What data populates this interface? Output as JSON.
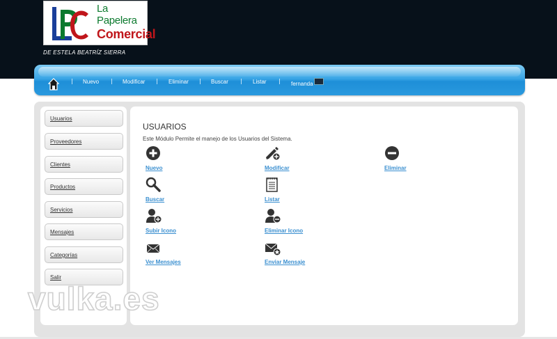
{
  "brand": {
    "logo_line1": "La",
    "logo_line2": "Papelera",
    "logo_line3": "Comercial",
    "tagline": "DE ESTELA BEATRÍZ SIERRA"
  },
  "nav": {
    "items": [
      {
        "label": "Nuevo"
      },
      {
        "label": "Modificar"
      },
      {
        "label": "Eliminar"
      },
      {
        "label": "Buscar"
      },
      {
        "label": "Listar"
      }
    ],
    "user": "fernanda"
  },
  "sidebar": {
    "items": [
      {
        "label": "Usuarios"
      },
      {
        "label": "Proveedores"
      },
      {
        "label": "Clientes"
      },
      {
        "label": "Productos"
      },
      {
        "label": "Servicios"
      },
      {
        "label": "Mensajes"
      },
      {
        "label": "Categorías"
      },
      {
        "label": "Salir"
      }
    ]
  },
  "main": {
    "title": "USUARIOS",
    "description": "Este Módulo Permite el manejo de los Usuarios del Sistema.",
    "actions": [
      {
        "label": "Nuevo",
        "icon": "plus-circle-icon"
      },
      {
        "label": "Modificar",
        "icon": "pencil-add-icon"
      },
      {
        "label": "Eliminar",
        "icon": "minus-circle-icon"
      },
      {
        "label": "Buscar",
        "icon": "magnifier-icon"
      },
      {
        "label": "Listar",
        "icon": "notepad-icon"
      },
      {
        "label": "Subir Icono",
        "icon": "user-add-icon"
      },
      {
        "label": "Eliminar Icono",
        "icon": "user-remove-icon"
      },
      {
        "label": "Ver Mensajes",
        "icon": "envelope-icon"
      },
      {
        "label": "Enviar Mensaje",
        "icon": "envelope-star-icon"
      }
    ]
  },
  "watermark": "vulka.es",
  "colors": {
    "header_bg": "#07111a",
    "nav_blue": "#2a99de",
    "link_blue": "#3a8fd0",
    "panel_gray": "#e3e3e3"
  }
}
